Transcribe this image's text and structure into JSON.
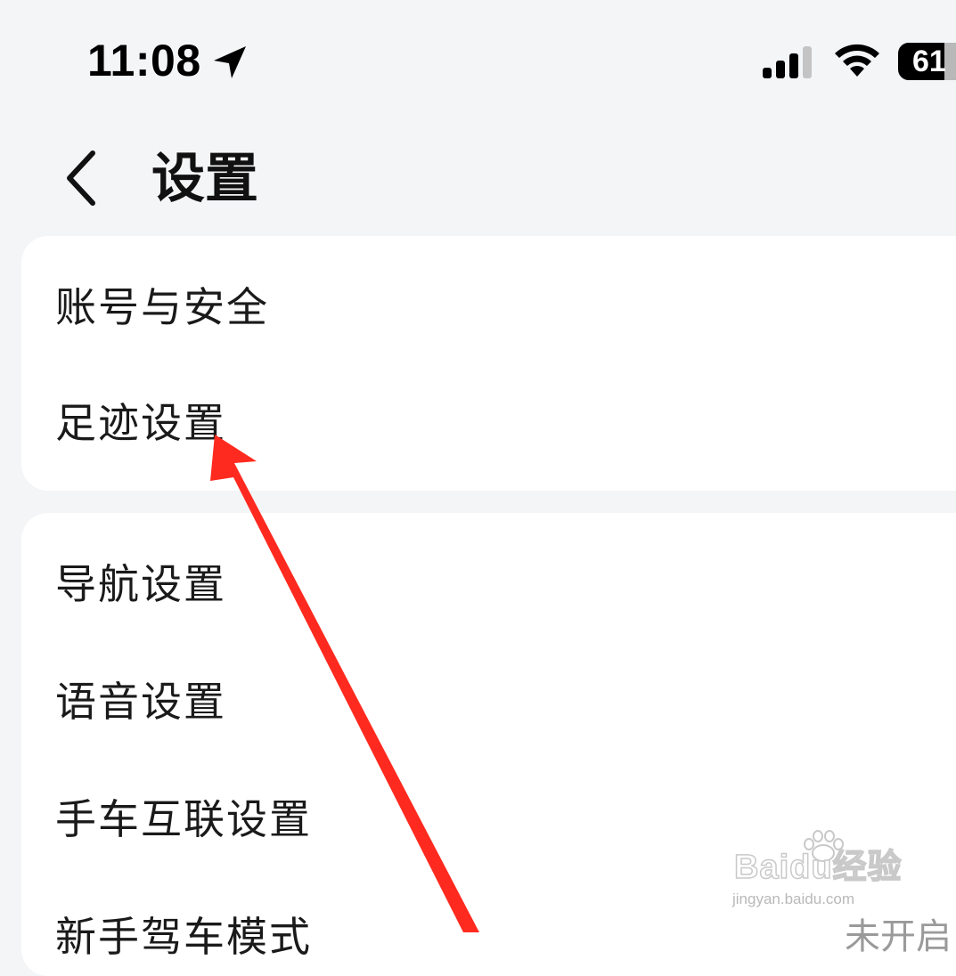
{
  "status_bar": {
    "time": "11:08",
    "battery_level": "61",
    "icons": [
      "location-arrow-icon",
      "cellular-signal-icon",
      "wifi-icon",
      "battery-icon"
    ]
  },
  "header": {
    "title": "设置",
    "back_icon": "chevron-left-icon"
  },
  "groups": [
    {
      "items": [
        {
          "label": "账号与安全"
        },
        {
          "label": "足迹设置"
        }
      ]
    },
    {
      "items": [
        {
          "label": "导航设置"
        },
        {
          "label": "语音设置"
        },
        {
          "label": "手车互联设置"
        },
        {
          "label": "新手驾车模式",
          "value": "未开启"
        }
      ]
    }
  ],
  "watermark": {
    "brand": "Baidu经验",
    "url": "jingyan.baidu.com"
  },
  "annotation": {
    "arrow_color": "#ff2a1f",
    "points_to": "足迹设置"
  },
  "colors": {
    "background": "#f4f5f7",
    "card": "#ffffff",
    "text_primary": "#1a1a1a",
    "text_secondary": "#9a9a9a"
  }
}
